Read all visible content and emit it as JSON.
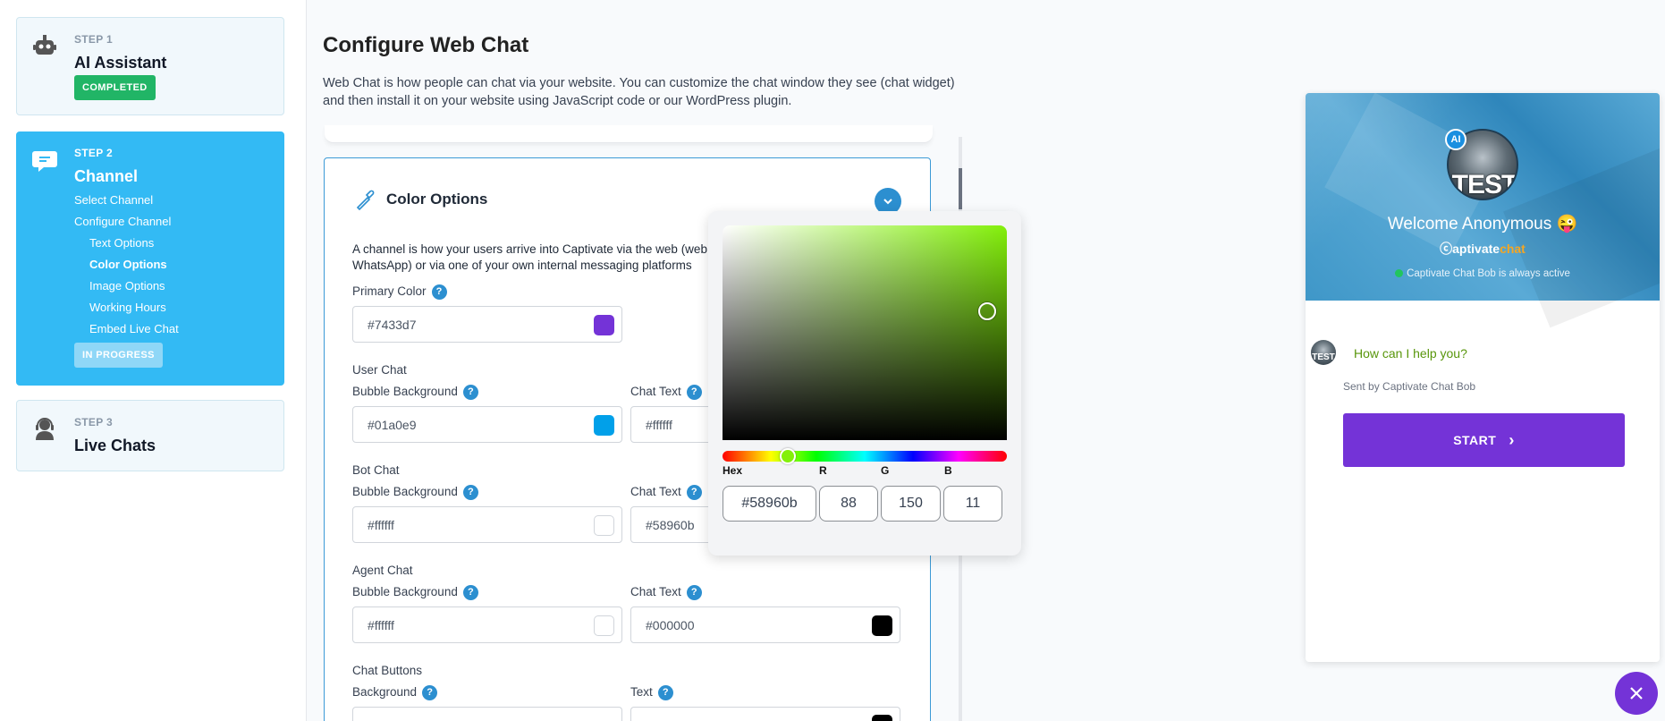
{
  "sidebar": {
    "step1": {
      "label": "STEP 1",
      "title": "AI Assistant",
      "badge": "COMPLETED",
      "icon": "robot-icon"
    },
    "step2": {
      "label": "STEP 2",
      "title": "Channel",
      "badge": "IN PROGRESS",
      "icon": "chat-icon",
      "items": [
        "Select Channel",
        "Configure Channel",
        "Text Options",
        "Color Options",
        "Image Options",
        "Working Hours",
        "Embed Live Chat"
      ],
      "active_item": "Color Options"
    },
    "step3": {
      "label": "STEP 3",
      "title": "Live Chats",
      "icon": "headset-icon"
    }
  },
  "main": {
    "title": "Configure Web Chat",
    "description": "Web Chat is how people can chat via your website. You can customize the chat window they see (chat widget) and then install it on your website using JavaScript code or our WordPress plugin."
  },
  "card": {
    "title": "Color Options",
    "description": "A channel is how your users arrive into Captivate via the web (web WhatsApp) or via one of your own internal messaging platforms",
    "primary_color_label": "Primary Color",
    "primary_color": "#7433d7",
    "user_chat": {
      "title": "User Chat",
      "bubble_label": "Bubble Background",
      "bubble": "#01a0e9",
      "text_label": "Chat Text",
      "text": "#ffffff"
    },
    "bot_chat": {
      "title": "Bot Chat",
      "bubble_label": "Bubble Background",
      "bubble": "#ffffff",
      "text_label": "Chat Text",
      "text": "#58960b"
    },
    "agent_chat": {
      "title": "Agent Chat",
      "bubble_label": "Bubble Background",
      "bubble": "#ffffff",
      "text_label": "Chat Text",
      "text": "#000000"
    },
    "chat_buttons": {
      "title": "Chat Buttons",
      "bg_label": "Background",
      "text_label": "Text"
    },
    "help_glyph": "?"
  },
  "picker": {
    "hex_label": "Hex",
    "r_label": "R",
    "g_label": "G",
    "b_label": "B",
    "hex": "#58960b",
    "r": "88",
    "g": "150",
    "b": "11",
    "hue_color": "#83f00a"
  },
  "widget": {
    "avatar_text": "TEST",
    "ai_badge": "AI",
    "welcome": "Welcome Anonymous 😜",
    "logo_part1": "ⓒaptivate",
    "logo_part2": "chat",
    "active_text": "Captivate Chat Bob is always active",
    "message": "How can I help you?",
    "sent_by": "Sent by Captivate Chat Bob",
    "start_label": "START",
    "start_glyph": "›",
    "close_glyph": "✕"
  }
}
